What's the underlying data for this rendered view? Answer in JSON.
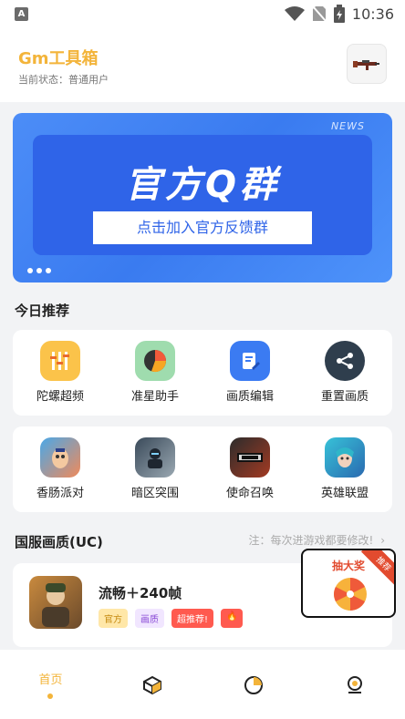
{
  "status_bar": {
    "time": "10:36",
    "left_icon": "A"
  },
  "header": {
    "app_title": "Gm工具箱",
    "status_text": "当前状态：普通用户"
  },
  "banner": {
    "badge": "NEWS",
    "headline": "官方Q群",
    "cta": "点击加入官方反馈群"
  },
  "today": {
    "title": "今日推荐",
    "tools": [
      {
        "label": "陀螺超频",
        "icon": "gyro-icon"
      },
      {
        "label": "准星助手",
        "icon": "crosshair-pie-icon"
      },
      {
        "label": "画质编辑",
        "icon": "edit-icon"
      },
      {
        "label": "重置画质",
        "icon": "share-icon"
      }
    ],
    "games": [
      {
        "label": "香肠派对",
        "icon": "sausage-party-icon"
      },
      {
        "label": "暗区突围",
        "icon": "arena-breakout-icon"
      },
      {
        "label": "使命召唤",
        "icon": "call-of-duty-icon"
      },
      {
        "label": "英雄联盟",
        "icon": "league-icon"
      }
    ]
  },
  "cn_quality": {
    "title": "国服画质(UC)",
    "note": "注：每次进游戏都要修改!",
    "item": {
      "name": "流畅＋240帧",
      "tags": [
        "官方",
        "画质",
        "超推荐!",
        "🔥"
      ]
    }
  },
  "lottery": {
    "title": "抽大奖",
    "ribbon": "推荐"
  },
  "tabbar": {
    "home": "首页"
  },
  "colors": {
    "accent": "#f3b43a",
    "banner": "#3a7bf0"
  }
}
